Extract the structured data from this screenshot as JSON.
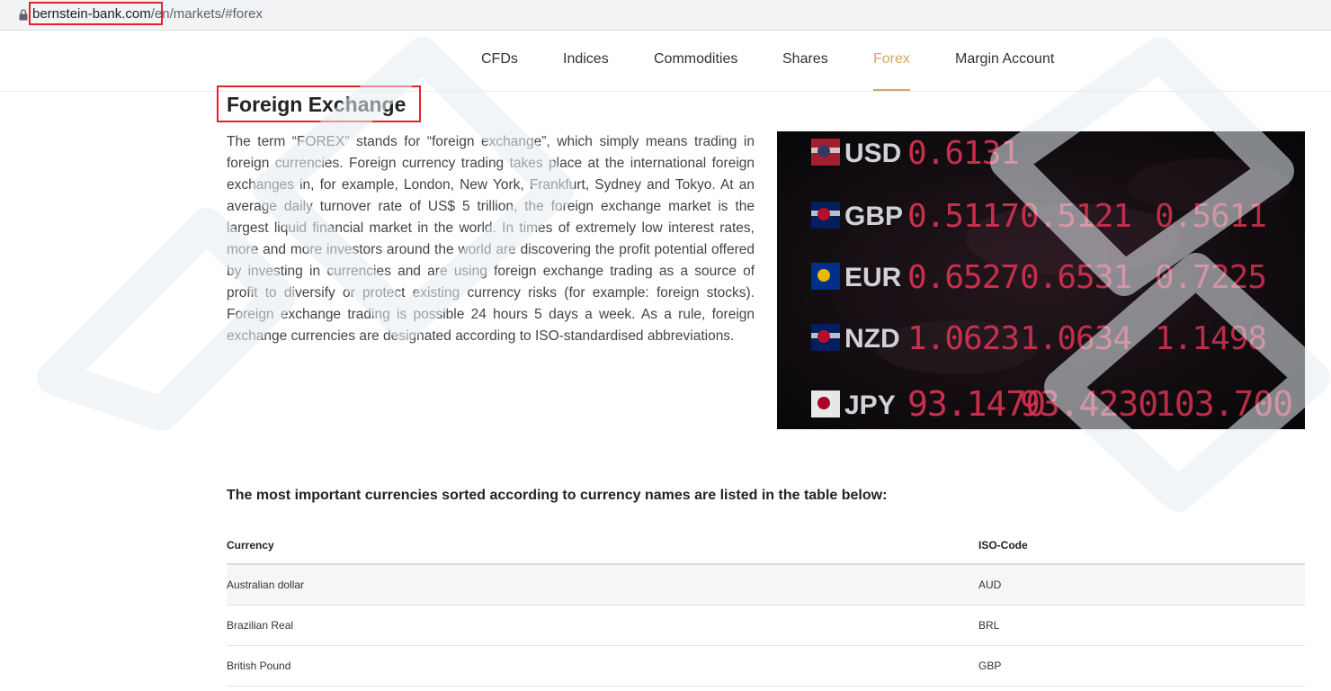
{
  "browser": {
    "url_host": "bernstein-bank.com",
    "url_path": "/en/markets/#forex"
  },
  "nav": {
    "items": [
      {
        "label": "CFDs",
        "active": false
      },
      {
        "label": "Indices",
        "active": false
      },
      {
        "label": "Commodities",
        "active": false
      },
      {
        "label": "Shares",
        "active": false
      },
      {
        "label": "Forex",
        "active": true
      },
      {
        "label": "Margin Account",
        "active": false
      }
    ],
    "accent_color": "#d2a862"
  },
  "page": {
    "title": "Foreign Exchange",
    "paragraph": "The term “FOREX” stands for “foreign exchange”, which simply means trading in foreign currencies. Foreign currency trading takes place at the international foreign exchanges in, for example, London, New York, Frankfurt, Sydney and Tokyo. At an average daily turnover rate of US$ 5 trillion, the foreign exchange market is the largest liquid financial market in the world. In times of extremely low interest rates, more and more investors around the world are discovering the profit potential offered by investing in currencies and are using foreign exchange trading as a source of profit to diversify or protect existing currency risks (for example: foreign stocks). Foreign exchange trading is possible 24 hours 5 days a week. As a rule, foreign exchange currencies are designated according to ISO-standardised abbreviations.",
    "subheading": "The most important currencies sorted according to currency names are listed in the table below:"
  },
  "board_image": {
    "rows": [
      {
        "code": "USD",
        "values": [
          "0.6131",
          "",
          ""
        ]
      },
      {
        "code": "GBP",
        "values": [
          "0.5117",
          "0.5121",
          "0.5611"
        ]
      },
      {
        "code": "EUR",
        "values": [
          "0.6527",
          "0.6531",
          "0.7225"
        ]
      },
      {
        "code": "NZD",
        "values": [
          "1.0623",
          "1.0634",
          "1.1498"
        ]
      },
      {
        "code": "JPY",
        "values": [
          "93.1470",
          "93.4230",
          "103.700"
        ]
      }
    ]
  },
  "table": {
    "headers": [
      "Currency",
      "ISO-Code"
    ],
    "rows": [
      [
        "Australian dollar",
        "AUD"
      ],
      [
        "Brazilian Real",
        "BRL"
      ],
      [
        "British Pound",
        "GBP"
      ]
    ]
  }
}
